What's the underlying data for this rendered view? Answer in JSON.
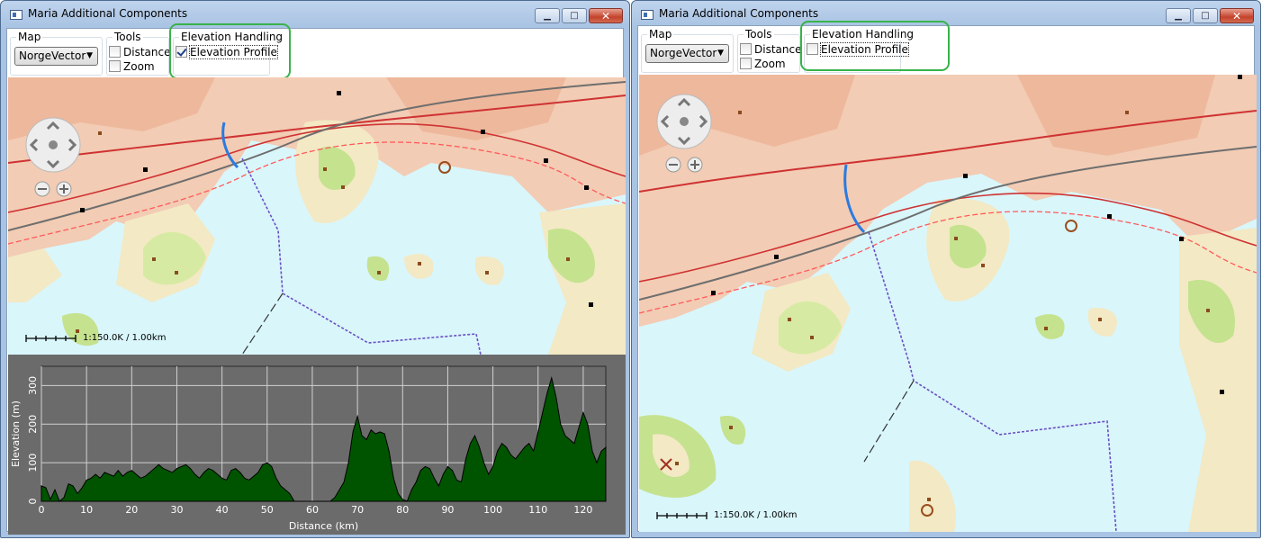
{
  "left_window": {
    "title": "Maria Additional Components",
    "map_group": {
      "label": "Map",
      "selected": "NorgeVector"
    },
    "tools_group": {
      "label": "Tools",
      "distance_label": "Distance",
      "distance_checked": false,
      "zoom_label": "Zoom",
      "zoom_checked": false
    },
    "elevation_group": {
      "label": "Elevation Handling",
      "profile_label": "Elevation Profile",
      "profile_checked": true
    },
    "scale_text": "1:150.0K / 1.00km"
  },
  "right_window": {
    "title": "Maria Additional Components",
    "map_group": {
      "label": "Map",
      "selected": "NorgeVector"
    },
    "tools_group": {
      "label": "Tools",
      "distance_label": "Distance",
      "distance_checked": false,
      "zoom_label": "Zoom",
      "zoom_checked": false
    },
    "elevation_group": {
      "label": "Elevation Handling",
      "profile_label": "Elevation Profile",
      "profile_checked": false
    },
    "scale_text": "1:150.0K / 1.00km"
  },
  "icons": {
    "app": "app-window-icon",
    "minimize": "minimize-icon",
    "maximize": "maximize-icon",
    "close": "close-icon",
    "pan": "pan-control-icon",
    "zoom_out": "zoom-out-icon",
    "zoom_in": "zoom-in-icon"
  },
  "colors": {
    "highlight": "#38b34a",
    "water": "#d9f6fb",
    "profile_fill": "#005400",
    "profile_bg": "#6b6b6b"
  },
  "chart_data": {
    "type": "area",
    "title": "",
    "xlabel": "Distance (km)",
    "ylabel": "Elevation (m)",
    "xlim": [
      0,
      125
    ],
    "ylim": [
      0,
      350
    ],
    "xticks": [
      0,
      10,
      20,
      30,
      40,
      50,
      60,
      70,
      80,
      90,
      100,
      110,
      120
    ],
    "yticks": [
      0,
      100,
      200,
      300
    ],
    "grid": true,
    "series": [
      {
        "x": [
          0,
          1,
          2,
          3,
          4,
          5,
          6,
          7,
          8,
          9,
          10,
          11,
          12,
          13,
          14,
          15,
          16,
          17,
          18,
          19,
          20,
          21,
          22,
          23,
          24,
          25,
          26,
          27,
          28,
          29,
          30,
          31,
          32,
          33,
          34,
          35,
          36,
          37,
          38,
          39,
          40,
          41,
          42,
          43,
          44,
          45,
          46,
          47,
          48,
          49,
          50,
          51,
          52,
          53,
          54,
          55,
          56,
          57,
          58,
          59,
          60,
          61,
          62,
          63,
          64,
          65,
          66,
          67,
          68,
          69,
          70,
          71,
          72,
          73,
          74,
          75,
          76,
          77,
          78,
          79,
          80,
          81,
          82,
          83,
          84,
          85,
          86,
          87,
          88,
          89,
          90,
          91,
          92,
          93,
          94,
          95,
          96,
          97,
          98,
          99,
          100,
          101,
          102,
          103,
          104,
          105,
          106,
          107,
          108,
          109,
          110,
          111,
          112,
          113,
          114,
          115,
          116,
          117,
          118,
          119,
          120,
          121,
          122,
          123,
          124,
          125
        ],
        "y": [
          40,
          35,
          5,
          30,
          0,
          10,
          45,
          40,
          20,
          35,
          55,
          60,
          70,
          60,
          75,
          70,
          65,
          80,
          65,
          75,
          80,
          70,
          60,
          65,
          75,
          85,
          95,
          85,
          80,
          75,
          85,
          90,
          95,
          85,
          70,
          60,
          75,
          85,
          80,
          70,
          60,
          55,
          80,
          85,
          75,
          60,
          55,
          65,
          75,
          95,
          100,
          90,
          60,
          40,
          30,
          20,
          0,
          0,
          0,
          0,
          0,
          0,
          0,
          0,
          0,
          10,
          30,
          50,
          100,
          180,
          220,
          170,
          160,
          185,
          175,
          180,
          175,
          130,
          60,
          20,
          5,
          0,
          30,
          50,
          80,
          90,
          85,
          60,
          40,
          70,
          90,
          80,
          55,
          50,
          110,
          150,
          170,
          140,
          100,
          70,
          90,
          130,
          150,
          140,
          120,
          110,
          125,
          140,
          150,
          130,
          180,
          230,
          280,
          320,
          270,
          200,
          170,
          160,
          150,
          190,
          230,
          200,
          130,
          100,
          130,
          140
        ]
      }
    ]
  }
}
